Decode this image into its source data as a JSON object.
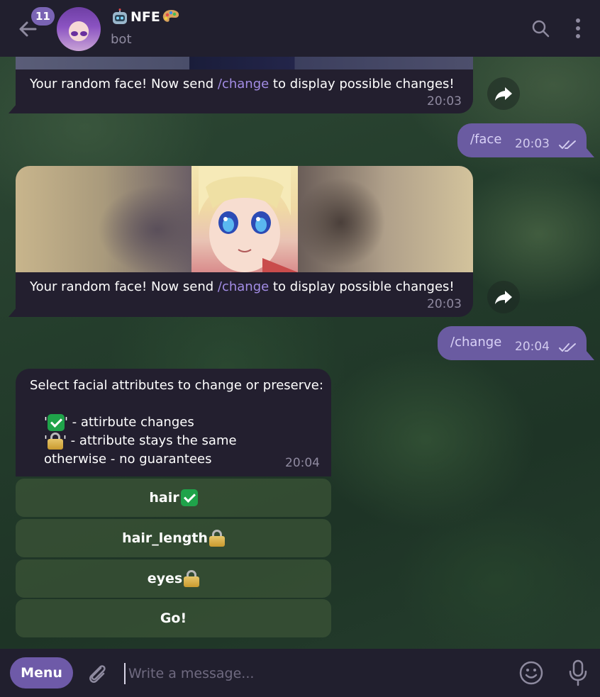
{
  "header": {
    "unread_count": "11",
    "title": "NFE",
    "subtitle": "bot"
  },
  "messages": [
    {
      "text_before": "Your random face! Now send ",
      "command": "/change",
      "text_after": " to display possible changes!",
      "time": "20:03"
    },
    {
      "out_text": "/face",
      "time": "20:03"
    },
    {
      "text_before": "Your random face! Now send ",
      "command": "/change",
      "text_after": " to display possible changes!",
      "time": "20:03"
    },
    {
      "out_text": "/change",
      "time": "20:04"
    },
    {
      "line1": "Select facial attributes to change or preserve:",
      "line2_suffix": "' - attirbute changes",
      "line3_suffix": "' - attribute stays the same",
      "line4": "otherwise - no guarantees",
      "quote": "'",
      "time": "20:04"
    }
  ],
  "keyboard": {
    "buttons": [
      {
        "label": "hair",
        "emoji": "check"
      },
      {
        "label": "hair_length",
        "emoji": "lock"
      },
      {
        "label": "eyes",
        "emoji": "lock"
      },
      {
        "label": "Go!",
        "emoji": ""
      }
    ]
  },
  "composer": {
    "menu_label": "Menu",
    "placeholder": "Write a message..."
  },
  "colors": {
    "header_bg": "#211f2e",
    "bubble_in": "#231f2f",
    "bubble_out": "#6a5ba1",
    "accent": "#6e5aa8",
    "command_link": "#a38de6"
  },
  "icons": [
    "back-arrow-icon",
    "robot-icon",
    "palette-icon",
    "search-icon",
    "more-vertical-icon",
    "forward-icon",
    "double-check-icon",
    "check-emoji-icon",
    "lock-emoji-icon",
    "paperclip-icon",
    "smile-icon",
    "microphone-icon"
  ]
}
